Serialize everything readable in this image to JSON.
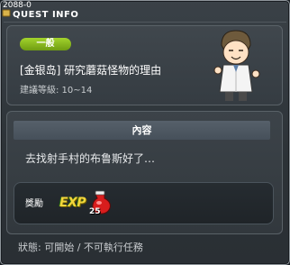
{
  "window": {
    "id_text": "2088-0",
    "title": "QUEST INFO"
  },
  "quest": {
    "category": "一般",
    "name": "[金银岛] 研究蘑菇怪物的理由",
    "level_range": "建議等級: 10~14"
  },
  "content": {
    "header": "內容",
    "text": "去找射手村的布鲁斯好了…"
  },
  "reward": {
    "label": "獎勵",
    "exp_label": "EXP",
    "item_count": "25"
  },
  "status": "狀態: 可開始 / 不可執行任務",
  "colors": {
    "badge": "#8dc21f",
    "accent_yellow": "#f2d63b"
  }
}
